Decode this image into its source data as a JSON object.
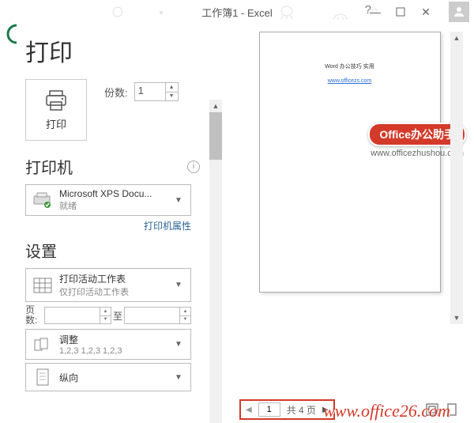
{
  "titlebar": {
    "title": "工作簿1 - Excel"
  },
  "page": {
    "heading": "打印",
    "print_button": "打印",
    "copies_label": "份数:",
    "copies_value": "1"
  },
  "printer": {
    "section": "打印机",
    "name": "Microsoft XPS Docu...",
    "status": "就绪",
    "properties_link": "打印机属性"
  },
  "settings": {
    "section": "设置",
    "scope": {
      "line1": "打印活动工作表",
      "line2": "仅打印活动工作表"
    },
    "pages": {
      "label": "页数:",
      "to": "至"
    },
    "collate": {
      "line1": "调整",
      "line2": "1,2,3  1,2,3  1,2,3"
    },
    "orientation": {
      "line1": "纵向"
    }
  },
  "preview": {
    "line1": "Word 办公技巧 实用",
    "line2": "www.officezs.com",
    "nav_current": "1",
    "nav_total": "共 4 页"
  },
  "watermark": {
    "badge": "Office办公助手",
    "badge_url": "www.officezhushou.com",
    "footer": "www.office26.com"
  }
}
